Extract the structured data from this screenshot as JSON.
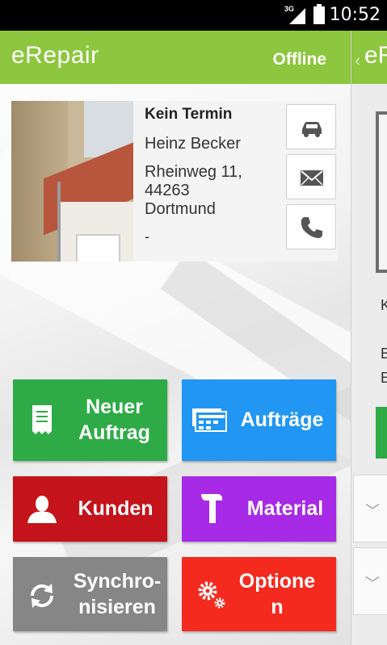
{
  "status_bar": {
    "network": "3G",
    "time": "10:52"
  },
  "app_bar": {
    "title": "eRepair",
    "connection_status": "Offline"
  },
  "customer_card": {
    "appointment": "Kein Termin",
    "name": "Heinz Becker",
    "street": "Rheinweg 11,",
    "zip": "44263",
    "city": "Dortmund",
    "note": "-",
    "actions": [
      {
        "icon": "car-icon"
      },
      {
        "icon": "mail-icon"
      },
      {
        "icon": "phone-icon"
      }
    ]
  },
  "tiles": [
    {
      "label_line1": "Neuer",
      "label_line2": "Auftrag",
      "icon": "receipt-icon",
      "color": "#2eab47"
    },
    {
      "label_line1": "Aufträge",
      "label_line2": "",
      "icon": "documents-icon",
      "color": "#2196f3"
    },
    {
      "label_line1": "Kunden",
      "label_line2": "",
      "icon": "person-icon",
      "color": "#c4131b"
    },
    {
      "label_line1": "Material",
      "label_line2": "",
      "icon": "hammer-icon",
      "color": "#a72ae6"
    },
    {
      "label_line1": "Synchro-",
      "label_line2": "nisieren",
      "icon": "sync-icon",
      "color": "#868686"
    },
    {
      "label_line1": "Optione",
      "label_line2": "n",
      "icon": "gears-icon",
      "color": "#f42a1f"
    }
  ],
  "side_panel": {
    "title": "eR",
    "letters": [
      "K",
      "B",
      "E"
    ]
  }
}
